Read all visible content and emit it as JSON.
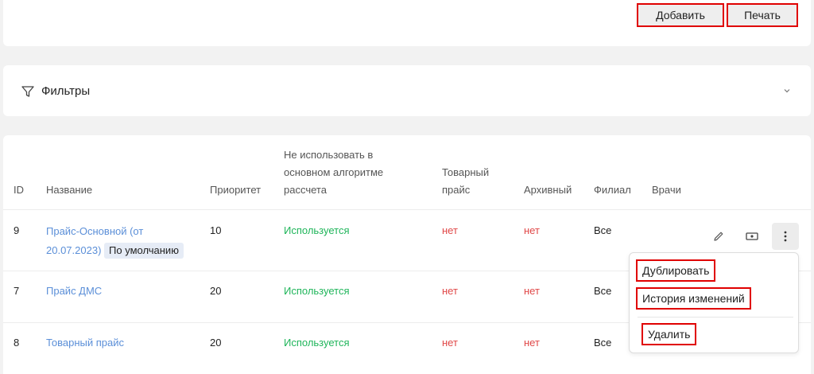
{
  "toolbar": {
    "add_label": "Добавить",
    "print_label": "Печать"
  },
  "filters": {
    "label": "Фильтры"
  },
  "table": {
    "headers": {
      "id": "ID",
      "name": "Название",
      "priority": "Приоритет",
      "no_main_line1": "Не использовать в",
      "no_main_line2": "основном алгоритме",
      "no_main_line3": "рассчета",
      "goods_line1": "Товарный",
      "goods_line2": "прайс",
      "archive": "Архивный",
      "branch": "Филиал",
      "doctors": "Врачи"
    },
    "rows": [
      {
        "id": "9",
        "name_line1": "Прайс-Основной (от",
        "name_line2": "20.07.2023)",
        "badge": "По умолчанию",
        "priority": "10",
        "usage": "Используется",
        "goods": "нет",
        "archive": "нет",
        "branch": "Все"
      },
      {
        "id": "7",
        "name": "Прайс ДМС",
        "priority": "20",
        "usage": "Используется",
        "goods": "нет",
        "archive": "нет",
        "branch": "Все"
      },
      {
        "id": "8",
        "name": "Товарный прайс",
        "priority": "20",
        "usage": "Используется",
        "goods": "нет",
        "archive": "нет",
        "branch": "Все"
      }
    ]
  },
  "menu": {
    "duplicate": "Дублировать",
    "history": "История изменений",
    "delete": "Удалить"
  },
  "colors": {
    "link": "#5b8fd8",
    "green": "#1fb55a",
    "red": "#e04848",
    "highlight": "#e00000"
  }
}
